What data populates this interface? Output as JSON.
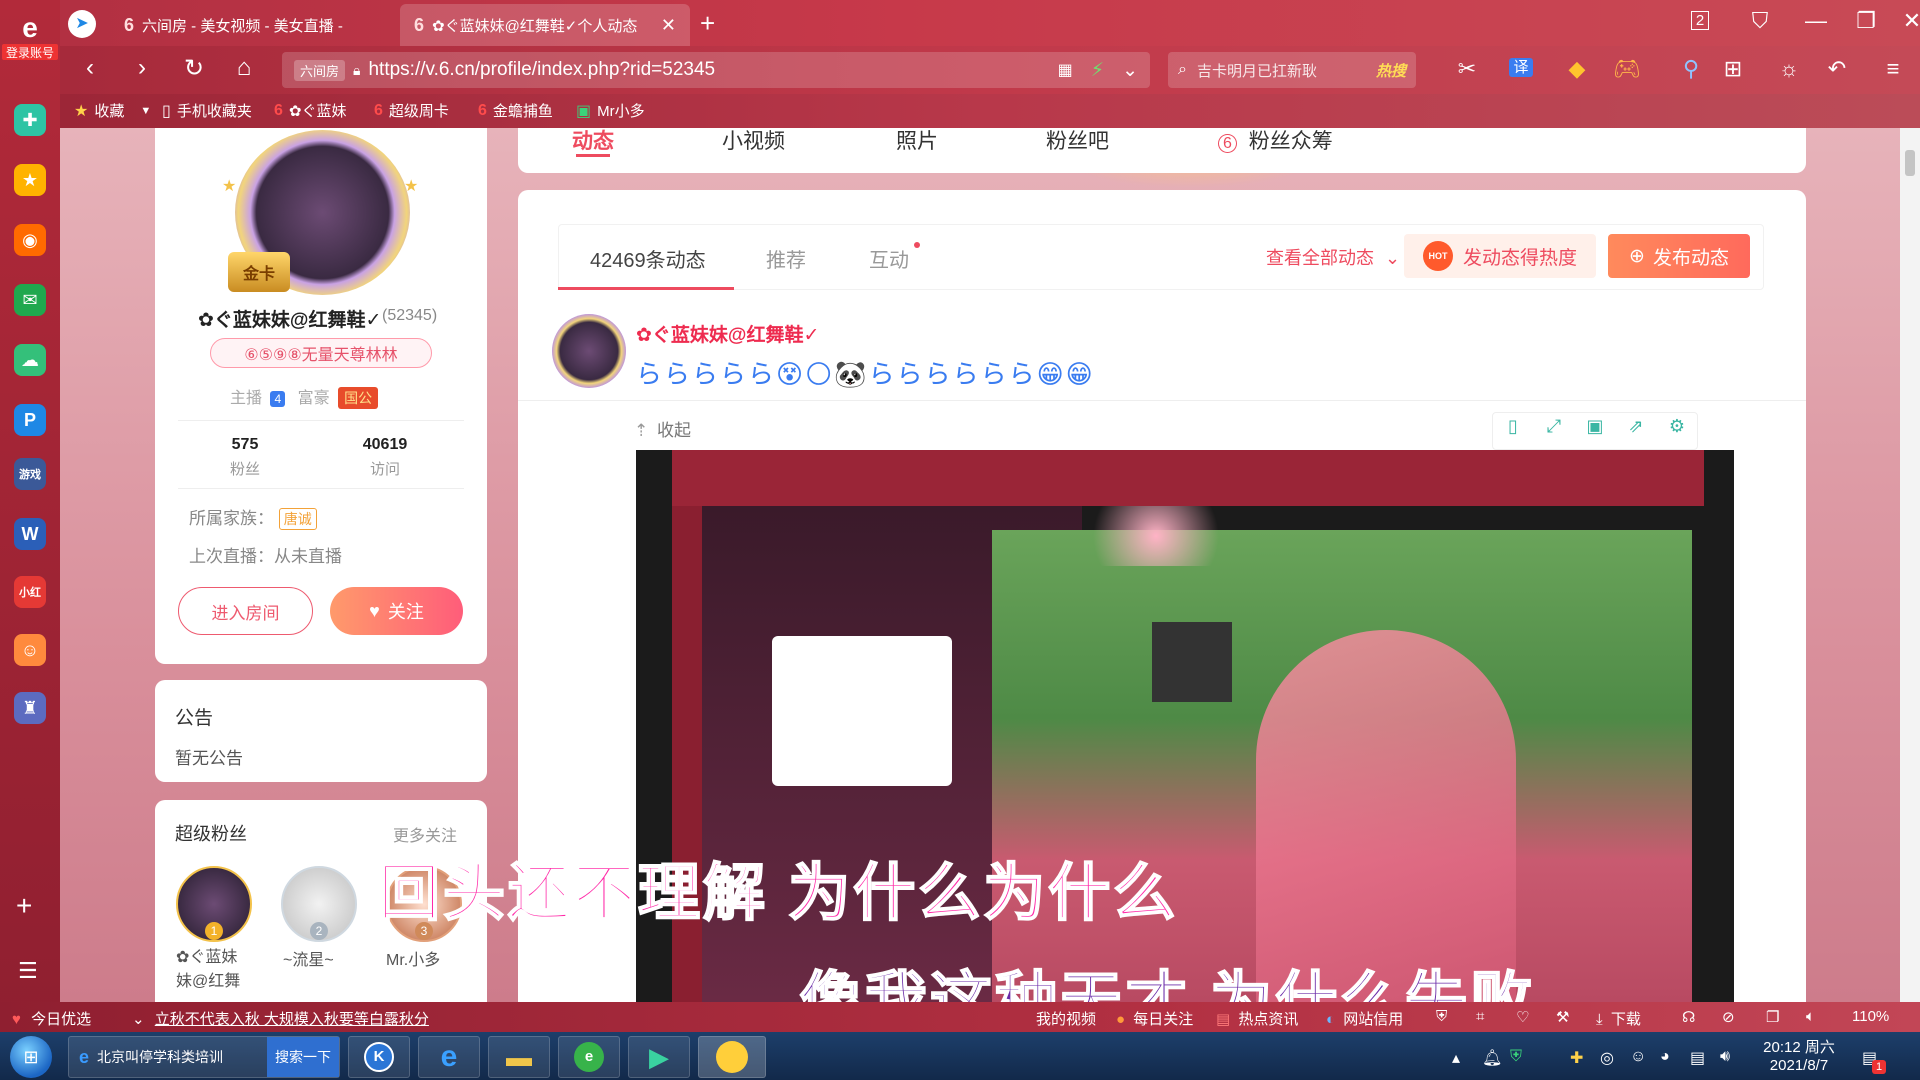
{
  "browser": {
    "tabs": [
      {
        "label": "六间房 - 美女视频 - 美女直播 -"
      },
      {
        "label": "✿ぐ蓝妹妹@红舞鞋✓个人动态"
      }
    ],
    "window_badge": "2",
    "left_rail_label": "登录账号",
    "url": "https://v.6.cn/profile/index.php?rid=52345",
    "url_prefix_badge": "六间房",
    "search_placeholder": "吉卡明月已扛新耿",
    "search_hot": "热搜",
    "translate_label": "译",
    "bookmarks": [
      {
        "label": "收藏"
      },
      {
        "label": "手机收藏夹"
      },
      {
        "label": "✿ぐ蓝妹"
      },
      {
        "label": "超级周卡"
      },
      {
        "label": "金蟾捕鱼"
      },
      {
        "label": "Mr小多"
      }
    ]
  },
  "profile": {
    "badge_text": "金卡",
    "nickname": "✿ぐ蓝妹妹@红舞鞋✓",
    "rid": "(52345)",
    "title_pill": "⑥⑤⑨⑧无量天尊林林",
    "anchor_label": "主播",
    "anchor_level": "4",
    "rich_label": "富豪",
    "rich_badge": "国公",
    "fans_count": "575",
    "fans_label": "粉丝",
    "visits_count": "40619",
    "visits_label": "访问",
    "family_label": "所属家族：",
    "family_tag": "唐诚",
    "last_live": "上次直播：从未直播",
    "enter_room": "进入房间",
    "follow": "关注"
  },
  "notice": {
    "title": "公告",
    "content": "暂无公告"
  },
  "super_fans": {
    "title": "超级粉丝",
    "more": "更多关注",
    "fans": [
      {
        "rank": "1",
        "name": "✿ぐ蓝妹\n妹@红舞"
      },
      {
        "rank": "2",
        "name": "~流星~"
      },
      {
        "rank": "3",
        "name": "Mr.小多"
      }
    ]
  },
  "top_nav": {
    "items": [
      {
        "label": "动态"
      },
      {
        "label": "小视频"
      },
      {
        "label": "照片"
      },
      {
        "label": "粉丝吧"
      },
      {
        "label": "粉丝众筹"
      }
    ]
  },
  "feed": {
    "tabs": [
      {
        "label": "42469条动态"
      },
      {
        "label": "推荐"
      },
      {
        "label": "互动"
      }
    ],
    "view_all": "查看全部动态",
    "heat_button": "发动态得热度",
    "post_button": "发布动态",
    "hot_badge": "HOT",
    "post": {
      "nickname": "✿ぐ蓝妹妹@红舞鞋✓",
      "content": "ららららら😵🌕🐼らららららら😁😁",
      "collapse": "收起"
    }
  },
  "subtitles": {
    "line1": "回头还不理解  为什么为什么",
    "line2": "像我这种天才  为什么失败"
  },
  "statusbar": {
    "today": "今日优选",
    "news": "立秋不代表入秋 大规模入秋要等白露秋分",
    "my_video": "我的视频",
    "daily": "每日关注",
    "hot_news": "热点资讯",
    "credit": "网站信用",
    "download": "下载",
    "zoom": "110%"
  },
  "taskbar": {
    "app1": "北京叫停学科类培训",
    "app1_btn": "搜索一下",
    "time": "20:12 周六",
    "date": "2021/8/7",
    "notify_count": "1"
  },
  "colors": {
    "accent": "#ee4b5f",
    "chrome_red": "#b23042",
    "link_blue": "#3a7cf0"
  }
}
